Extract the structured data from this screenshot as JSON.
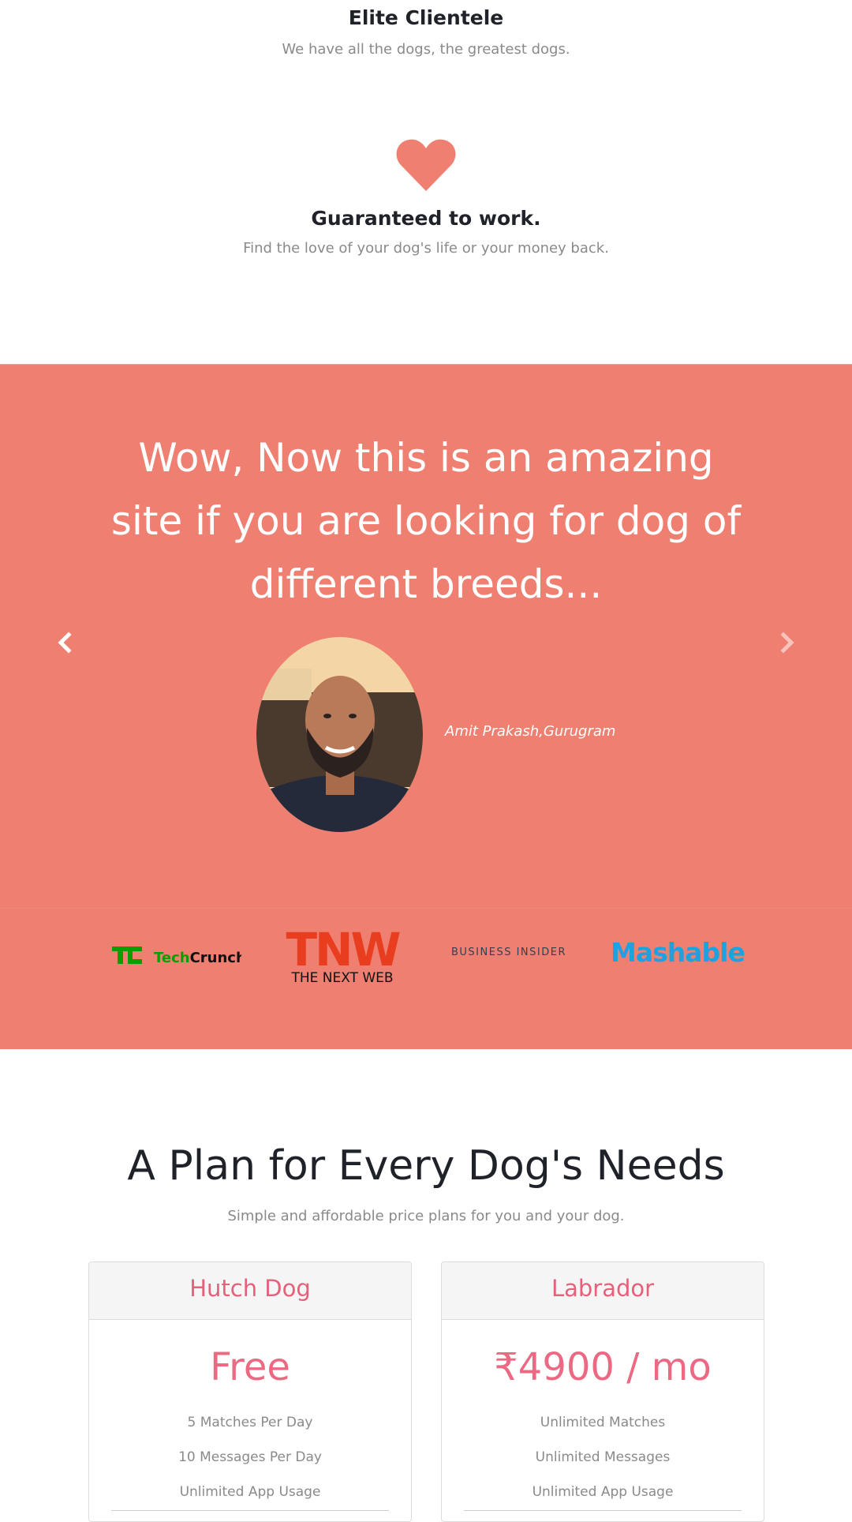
{
  "features": [
    {
      "title": "Elite Clientele",
      "subtitle": "We have all the dogs, the greatest dogs."
    },
    {
      "icon": "heart-icon",
      "title": "Guaranteed to work.",
      "subtitle": "Find the love of your dog's life or your money back."
    }
  ],
  "testimonial": {
    "quote": "Wow, Now this is an amazing site if you are looking for dog of different breeds...",
    "author": "Amit Prakash,Gurugram",
    "prev_icon": "chevron-left-icon",
    "next_icon": "chevron-right-icon"
  },
  "press": {
    "logos": [
      "TechCrunch",
      "THE NEXT WEB",
      "BUSINESS INSIDER",
      "Mashable"
    ],
    "techcrunch": "TechCrunch",
    "tnw_mark": "TNW",
    "tnw_text": "THE NEXT WEB",
    "business_insider": "BUSINESS INSIDER",
    "mashable": "Mashable"
  },
  "pricing": {
    "title": "A Plan for Every Dog's Needs",
    "subtitle": "Simple and affordable price plans for you and your dog.",
    "plans": [
      {
        "name": "Hutch Dog",
        "price": "Free",
        "features": [
          "5 Matches Per Day",
          "10 Messages Per Day",
          "Unlimited App Usage"
        ]
      },
      {
        "name": "Labrador",
        "price": "₹4900 / mo",
        "features": [
          "Unlimited Matches",
          "Unlimited Messages",
          "Unlimited App Usage"
        ]
      }
    ]
  },
  "colors": {
    "accent_coral": "#ef7f71",
    "plan_pink": "#e5607a",
    "heading_dark": "#1f2329",
    "muted_text": "#8a8a8a",
    "techcrunch_green": "#0a9e01",
    "tnw_red": "#e83e1f",
    "mashable_blue": "#1da2df"
  }
}
